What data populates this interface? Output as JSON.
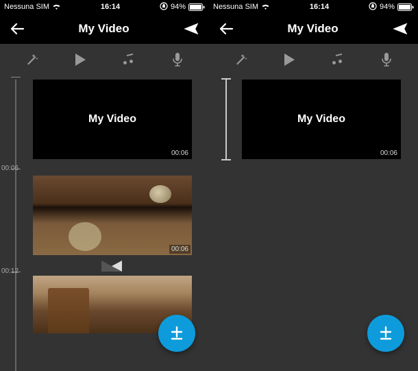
{
  "status": {
    "carrier": "Nessuna SIM",
    "time": "16:14",
    "battery_pct": "94%"
  },
  "header": {
    "title": "My Video"
  },
  "left": {
    "title_clip": {
      "text": "My Video",
      "duration": "00:06"
    },
    "time_labels": {
      "t1": "00:06",
      "t2": "00:12"
    },
    "clip2_duration": "00:06"
  },
  "right": {
    "title_clip": {
      "text": "My Video",
      "duration": "00:06"
    }
  }
}
